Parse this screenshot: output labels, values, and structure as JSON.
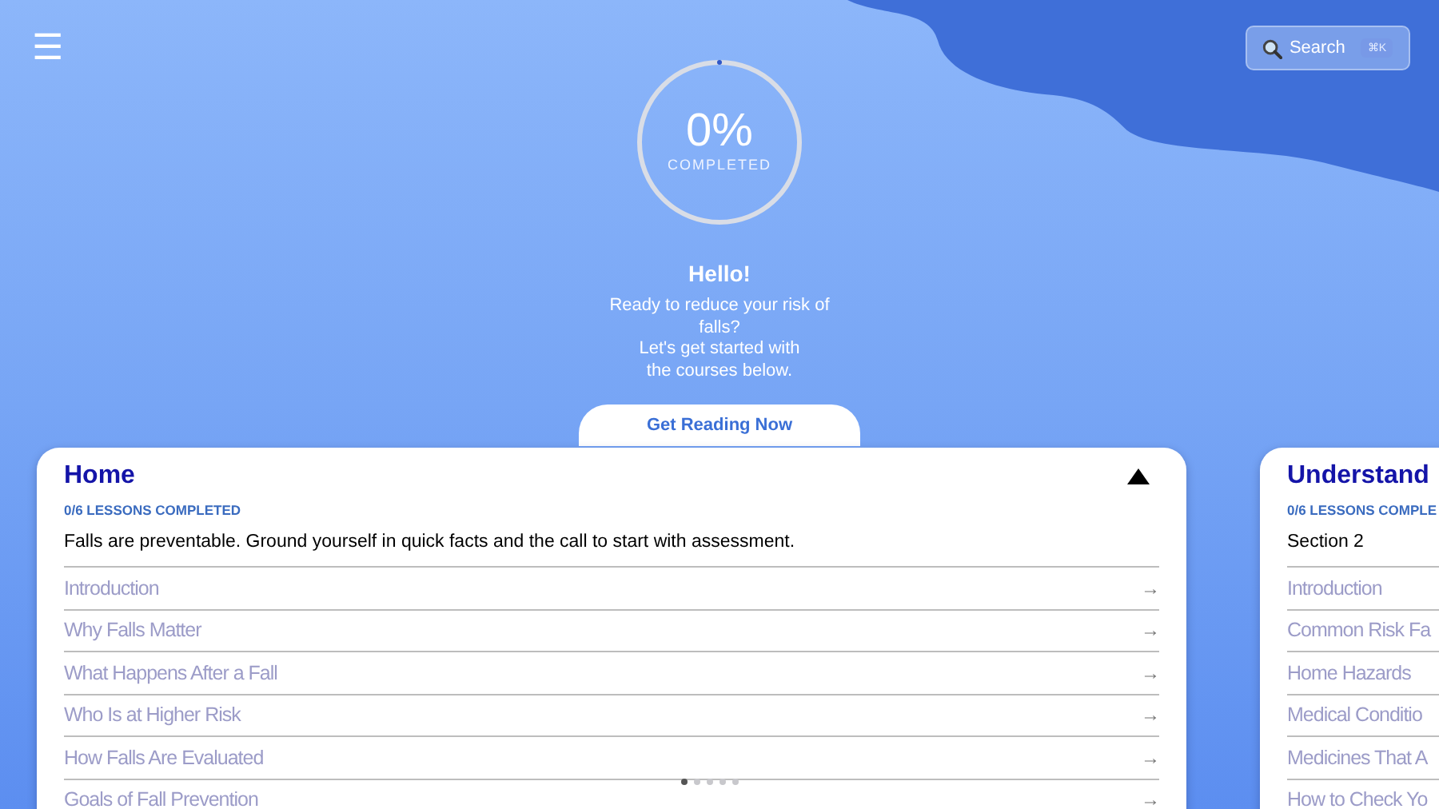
{
  "menu_button": {
    "label": "☰"
  },
  "search": {
    "label": "Search",
    "shortcut": "⌘K"
  },
  "progress": {
    "value": "0%",
    "caption": "COMPLETED"
  },
  "greeting": {
    "title": "Hello!",
    "lines": [
      "Ready to reduce your risk of",
      "falls?",
      "Let's get started with",
      "the courses below."
    ]
  },
  "cta_button": "Get Reading Now",
  "courses": [
    {
      "title": "Home",
      "count": "0/6 LESSONS COMPLETED",
      "description": "Falls are preventable. Ground yourself in quick facts and the call to start with assessment.",
      "expanded": true,
      "lessons": [
        {
          "label": "Introduction",
          "arrow": "→"
        },
        {
          "label": "Why Falls Matter",
          "arrow": "→"
        },
        {
          "label": "What Happens After a Fall",
          "arrow": "→"
        },
        {
          "label": "Who Is at Higher Risk",
          "arrow": "→"
        },
        {
          "label": "How Falls Are Evaluated",
          "arrow": "→"
        },
        {
          "label": "Goals of Fall Prevention",
          "arrow": "→"
        }
      ]
    },
    {
      "title": "Understand",
      "count": "0/6 LESSONS COMPLE",
      "description": "Section 2",
      "lessons": [
        {
          "label": "Introduction"
        },
        {
          "label": "Common Risk Fa"
        },
        {
          "label": "Home Hazards"
        },
        {
          "label": "Medical Conditio"
        },
        {
          "label": "Medicines That A"
        },
        {
          "label": "How to Check Yo"
        }
      ]
    }
  ],
  "pages": [
    {
      "selected": true
    },
    {
      "selected": false
    },
    {
      "selected": false
    },
    {
      "selected": false
    },
    {
      "selected": false
    }
  ]
}
